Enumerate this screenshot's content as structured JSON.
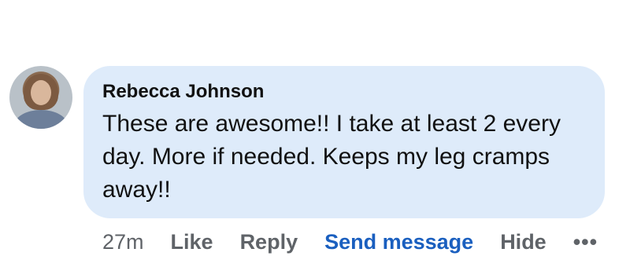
{
  "comment": {
    "author": "Rebecca Johnson",
    "text": "These are awesome!! I take at least 2 every day. More if needed. Keeps my leg cramps away!!",
    "timestamp": "27m",
    "actions": {
      "like": "Like",
      "reply": "Reply",
      "send_message": "Send message",
      "hide": "Hide",
      "more": "•••"
    },
    "avatar_icon": "user-photo",
    "colors": {
      "bubble": "#deebfa",
      "link": "#1a5fbf",
      "muted": "#5f6368"
    }
  }
}
